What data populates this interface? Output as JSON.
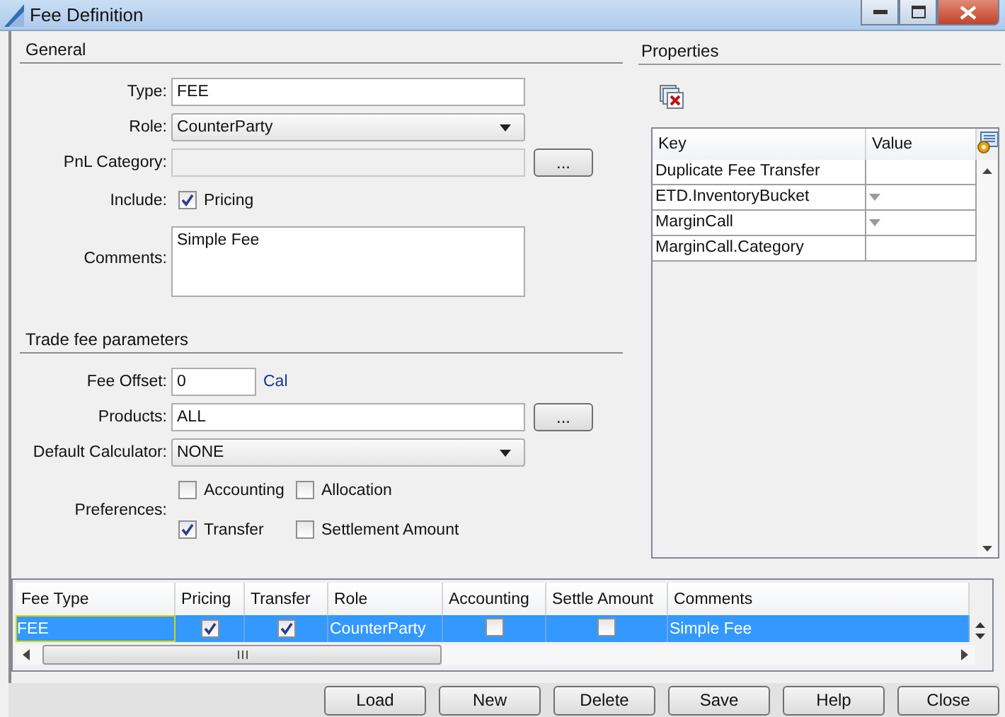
{
  "window": {
    "title": "Fee Definition"
  },
  "general": {
    "heading": "General",
    "fields": [
      {
        "kind": "text",
        "label": "Type:",
        "value": "FEE"
      },
      {
        "kind": "dropdown",
        "label": "Role:",
        "value": "CounterParty"
      },
      {
        "kind": "text_button",
        "label": "PnL Category:",
        "disabled": true,
        "button": "..."
      },
      {
        "kind": "checkboxes",
        "label": "Include:",
        "options": [
          {
            "label": "Pricing",
            "checked": true
          }
        ]
      },
      {
        "kind": "textarea",
        "label": "Comments:",
        "value": "Simple Fee"
      }
    ]
  },
  "trade_fee_parameters": {
    "heading": "Trade fee parameters",
    "fields": [
      {
        "kind": "text_unit",
        "label": "Fee Offset:",
        "value": "0",
        "unit": "Cal"
      },
      {
        "kind": "text_button",
        "label": "Products:",
        "value": "ALL",
        "disabled": false,
        "button": "..."
      },
      {
        "kind": "dropdown",
        "label": "Default Calculator:",
        "value": "NONE"
      },
      {
        "kind": "checkboxes",
        "label": "Preferences:",
        "options": [
          {
            "label": "Accounting",
            "checked": false
          },
          {
            "label": "Allocation",
            "checked": false
          },
          {
            "label": "Transfer",
            "checked": true
          },
          {
            "label": "Settlement Amount",
            "checked": false
          }
        ]
      }
    ]
  },
  "properties": {
    "heading": "Properties",
    "columns": [
      "Key",
      "Value"
    ],
    "rows": [
      {
        "key": "Duplicate Fee Transfer",
        "kind": "text"
      },
      {
        "key": "ETD.InventoryBucket",
        "kind": "dropdown"
      },
      {
        "key": "MarginCall",
        "kind": "dropdown"
      },
      {
        "key": "MarginCall.Category",
        "kind": "text"
      }
    ]
  },
  "fee_table": {
    "columns": [
      "Fee Type",
      "Pricing",
      "Transfer",
      "Role",
      "Accounting",
      "Settle Amount",
      "Comments"
    ],
    "rows": [
      {
        "selected": true,
        "cells": [
          {
            "kind": "text",
            "text": "FEE"
          },
          {
            "kind": "check",
            "checked": true
          },
          {
            "kind": "check",
            "checked": true
          },
          {
            "kind": "text",
            "text": "CounterParty"
          },
          {
            "kind": "check",
            "checked": false
          },
          {
            "kind": "check",
            "checked": false
          },
          {
            "kind": "text",
            "text": "Simple Fee"
          }
        ]
      }
    ]
  },
  "buttons": [
    "Load",
    "New",
    "Delete",
    "Save",
    "Help",
    "Close"
  ]
}
